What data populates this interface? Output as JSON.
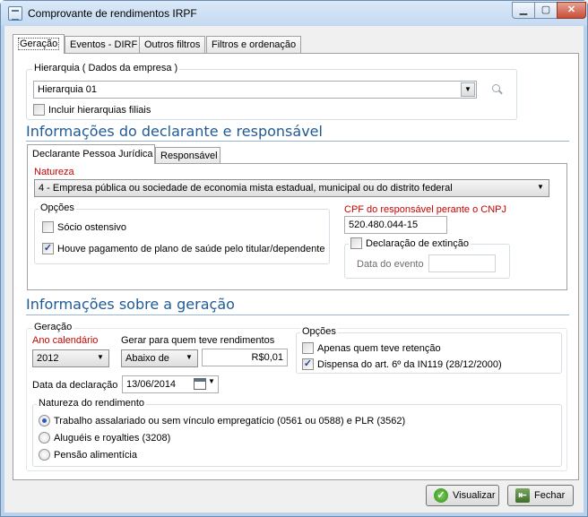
{
  "window": {
    "title": "Comprovante de rendimentos IRPF",
    "controls": {
      "minimize": "▁",
      "maximize": "▢",
      "close": "✕"
    }
  },
  "tabs": [
    "Geração",
    "Eventos - DIRF",
    "Outros filtros",
    "Filtros e ordenação"
  ],
  "hierarquia": {
    "caption": "Hierarquia ( Dados da empresa )",
    "value": "Hierarquia 01",
    "include_label": "Incluir hierarquias filiais",
    "include_checked": false
  },
  "declarante": {
    "section_title": "Informações do declarante e responsável",
    "subtabs": [
      "Declarante Pessoa Jurídica",
      "Responsável"
    ],
    "natureza_label": "Natureza",
    "natureza_value": "4 - Empresa pública ou sociedade de economia mista estadual, municipal ou do distrito federal",
    "opcoes_caption": "Opções",
    "socio_label": "Sócio ostensivo",
    "socio_checked": false,
    "plano_saude_label": "Houve pagamento de plano de saúde pelo titular/dependente",
    "plano_saude_checked": true,
    "cpf_label": "CPF do responsável perante o CNPJ",
    "cpf_value": "520.480.044-15",
    "extincao_label": "Declaração de extinção",
    "extincao_checked": false,
    "data_evento_label": "Data do evento",
    "data_evento_value": ""
  },
  "geracao": {
    "section_title": "Informações sobre a geração",
    "caption": "Geração",
    "ano_label": "Ano calendário",
    "ano_value": "2012",
    "gerar_label": "Gerar para quem teve rendimentos",
    "gerar_value": "Abaixo de",
    "valor": "R$0,01",
    "data_declaracao_label": "Data da declaração",
    "data_declaracao_value": "13/06/2014",
    "opcoes_caption": "Opções",
    "retencao_label": "Apenas quem teve retenção",
    "retencao_checked": false,
    "dispensa_label": "Dispensa do art. 6º da IN119 (28/12/2000)",
    "dispensa_checked": true,
    "natureza_caption": "Natureza do rendimento",
    "natureza_options": [
      "Trabalho assalariado ou sem vínculo empregatício (0561 ou 0588) e PLR (3562)",
      "Aluguéis e royalties (3208)",
      "Pensão alimentícia"
    ],
    "natureza_selected_index": 0
  },
  "footer": {
    "visualizar_label": "Visualizar",
    "fechar_label": "Fechar"
  },
  "colors": {
    "section_title": "#1f5a95",
    "required_label": "#cc0000",
    "window_frame": "#b9d1ea"
  }
}
